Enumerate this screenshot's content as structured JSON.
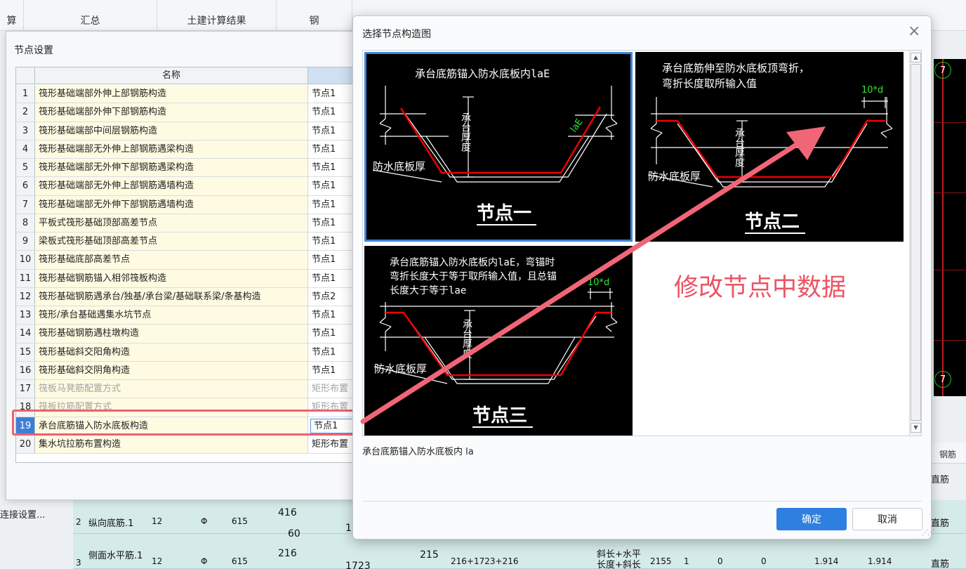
{
  "background": {
    "headers": [
      "算",
      "汇总",
      "土建计算结果",
      "钢"
    ],
    "link_label": "连接设置...",
    "right_header": "钢筋",
    "axis_label": "7",
    "rows": [
      {
        "no": "2",
        "name": "纵向底筋.1",
        "dia": "12",
        "grade": "Φ",
        "len": "615",
        "a": "416",
        "b": "60",
        "c": "1",
        "type": "直筋"
      },
      {
        "no": "3",
        "name": "侧面水平筋.1",
        "dia": "12",
        "grade": "Φ",
        "len": "615",
        "a": "216",
        "b": "1723",
        "c": "215",
        "formula": "216+1723+216",
        "desc": "斜长+水平长度+斜长",
        "total": "2155",
        "n1": "1",
        "n2": "0",
        "n3": "0",
        "w1": "1.914",
        "w2": "1.914",
        "type": "直筋"
      }
    ],
    "row1_type": "直筋"
  },
  "node_settings": {
    "title": "节点设置",
    "col_name": "名称",
    "rows": [
      {
        "idx": "1",
        "name": "筏形基础端部外伸上部钢筋构造",
        "value": "节点1"
      },
      {
        "idx": "2",
        "name": "筏形基础端部外伸下部钢筋构造",
        "value": "节点1"
      },
      {
        "idx": "3",
        "name": "筏形基础端部中间层钢筋构造",
        "value": "节点1"
      },
      {
        "idx": "4",
        "name": "筏形基础端部无外伸上部钢筋遇梁构造",
        "value": "节点1"
      },
      {
        "idx": "5",
        "name": "筏形基础端部无外伸下部钢筋遇梁构造",
        "value": "节点1"
      },
      {
        "idx": "6",
        "name": "筏形基础端部无外伸上部钢筋遇墙构造",
        "value": "节点1"
      },
      {
        "idx": "7",
        "name": "筏形基础端部无外伸下部钢筋遇墙构造",
        "value": "节点1"
      },
      {
        "idx": "8",
        "name": "平板式筏形基础顶部高差节点",
        "value": "节点1"
      },
      {
        "idx": "9",
        "name": "梁板式筏形基础顶部高差节点",
        "value": "节点1"
      },
      {
        "idx": "10",
        "name": "筏形基础底部高差节点",
        "value": "节点1"
      },
      {
        "idx": "11",
        "name": "筏形基础钢筋锚入相邻筏板构造",
        "value": "节点1"
      },
      {
        "idx": "12",
        "name": "筏形基础钢筋遇承台/独基/承台梁/基础联系梁/条基构造",
        "value": "节点2"
      },
      {
        "idx": "13",
        "name": "筏形/承台基础遇集水坑节点",
        "value": "节点1"
      },
      {
        "idx": "14",
        "name": "筏形基础钢筋遇柱墩构造",
        "value": "节点1"
      },
      {
        "idx": "15",
        "name": "筏形基础斜交阳角构造",
        "value": "节点1"
      },
      {
        "idx": "16",
        "name": "筏形基础斜交阴角构造",
        "value": "节点1"
      },
      {
        "idx": "17",
        "name": "筏板马凳筋配置方式",
        "value": "矩形布置"
      },
      {
        "idx": "18",
        "name": "筏板拉筋配置方式",
        "value": "矩形布置"
      },
      {
        "idx": "19",
        "name": "承台底筋锚入防水底板构造",
        "value": "节点1"
      },
      {
        "idx": "20",
        "name": "集水坑拉筋布置构造",
        "value": "矩形布置"
      }
    ]
  },
  "select_dialog": {
    "title": "选择节点构造图",
    "close_glyph": "×",
    "nodes": [
      {
        "caption": "节点一",
        "line1": "承台底筋锚入防水底板内laE",
        "line2": "",
        "line3": "",
        "dim": "laE",
        "thick": "承台厚度",
        "waterproof": "防水底板厚"
      },
      {
        "caption": "节点二",
        "line1": "承台底筋伸至防水底板顶弯折，",
        "line2": "弯折长度取所输入值",
        "line3": "",
        "dim": "10*d",
        "thick": "承台厚度",
        "waterproof": "防水底板厚"
      },
      {
        "caption": "节点三",
        "line1": "承台底筋锚入防水底板内laE，弯锚时",
        "line2": "弯折长度大于等于取所输入值，且总锚",
        "line3": "长度大于等于lae",
        "dim": "10*d",
        "thick": "承台厚度",
        "waterproof": "防水底板厚"
      }
    ],
    "description": "承台底筋锚入防水底板内 la",
    "ok_label": "确定",
    "cancel_label": "取消"
  },
  "annotation": {
    "text": "修改节点中数据",
    "color": "#ec5464"
  }
}
